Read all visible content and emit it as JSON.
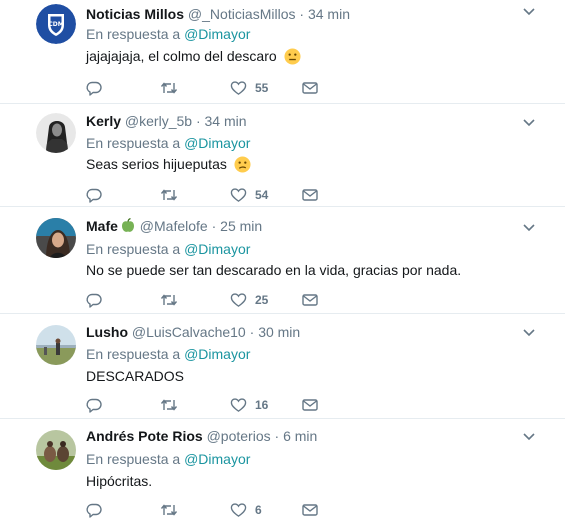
{
  "reply_prefix": "En respuesta a",
  "colors": {
    "mention": "#1b95a0",
    "muted": "#657786",
    "divider": "#e6ecf0"
  },
  "tweets": [
    {
      "name": "Noticias Millos",
      "handle": "@_NoticiasMillos",
      "separator": "·",
      "time": "34 min",
      "mention": "@Dimayor",
      "text": "jajajajaja, el colmo del descaro",
      "emoji": "neutral-face-icon",
      "likes": "55"
    },
    {
      "name": "Kerly",
      "handle": "@kerly_5b",
      "separator": "·",
      "time": "34 min",
      "mention": "@Dimayor",
      "text": "Seas serios hijueputas",
      "emoji": "confused-face-icon",
      "likes": "54"
    },
    {
      "name": "Mafe",
      "handle": "@Mafelofe",
      "separator": "·",
      "time": "25 min",
      "mention": "@Dimayor",
      "text": "No se puede ser tan descarado en la vida, gracias por nada.",
      "emoji": "green-apple-icon",
      "likes": "25"
    },
    {
      "name": "Lusho",
      "handle": "@LuisCalvache10",
      "separator": "·",
      "time": "30 min",
      "mention": "@Dimayor",
      "text": "DESCARADOS",
      "likes": "16"
    },
    {
      "name": "Andrés Pote Rios",
      "handle": "@poterios",
      "separator": "·",
      "time": "6 min",
      "mention": "@Dimayor",
      "text": "Hipócritas.",
      "likes": "6"
    }
  ]
}
